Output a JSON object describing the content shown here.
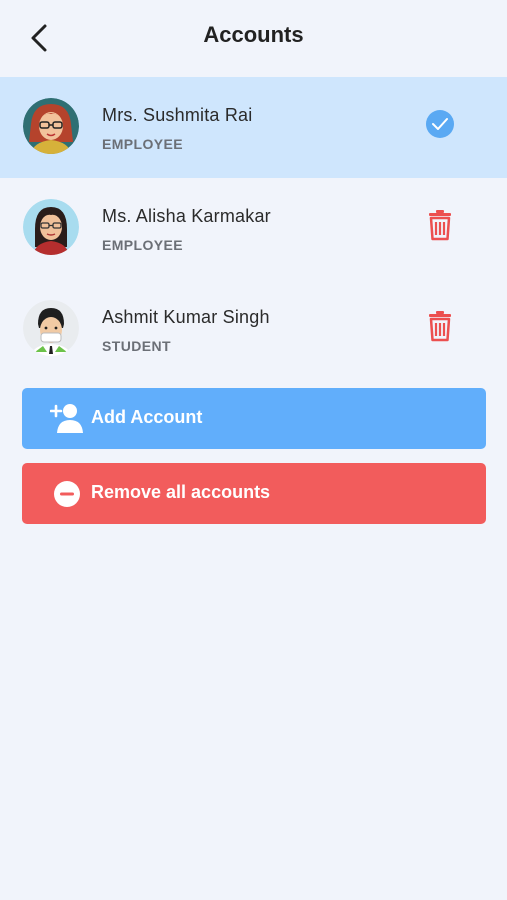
{
  "header": {
    "title": "Accounts",
    "back_icon": "chevron-left-icon"
  },
  "accounts": [
    {
      "name": "Mrs. Sushmita Rai",
      "role": "EMPLOYEE",
      "active": true,
      "action_icon": "check-circle-icon"
    },
    {
      "name": "Ms. Alisha Karmakar",
      "role": "EMPLOYEE",
      "active": false,
      "action_icon": "trash-icon"
    },
    {
      "name": "Ashmit Kumar Singh",
      "role": "STUDENT",
      "active": false,
      "action_icon": "trash-icon"
    }
  ],
  "buttons": {
    "add_label": "Add Account",
    "add_icon": "add-user-icon",
    "remove_label": "Remove all accounts",
    "remove_icon": "minus-circle-icon"
  },
  "colors": {
    "background": "#f1f4fb",
    "active_row": "#cfe6fd",
    "add_button": "#61aefb",
    "remove_button": "#f25c5c",
    "check": "#5aa9f3",
    "trash": "#ec4f4f"
  }
}
